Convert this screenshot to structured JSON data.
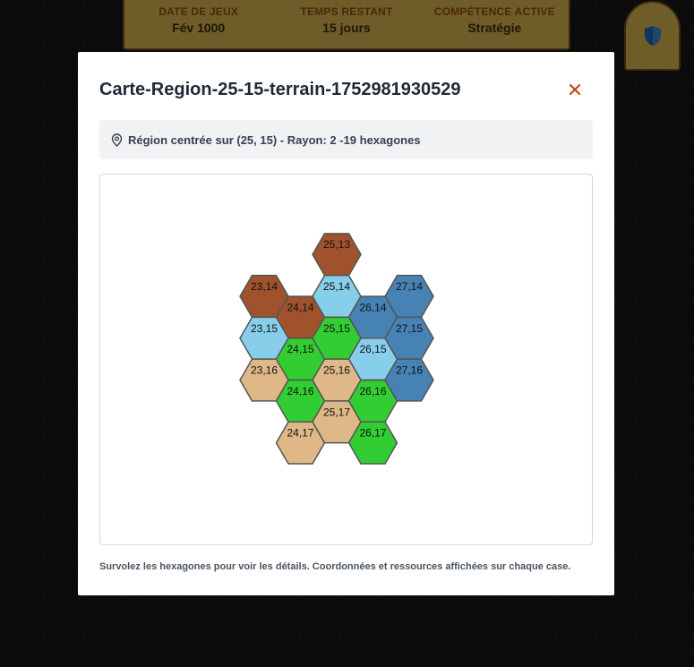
{
  "status_bar": {
    "stats": [
      {
        "label": "DATE DE JEUX",
        "value": "Fév 1000"
      },
      {
        "label": "TEMPS RESTANT",
        "value": "15 jours"
      },
      {
        "label": "COMPÉTENCE ACTIVE",
        "value": "Stratégie"
      }
    ]
  },
  "shield_button": {
    "icon": "shield-icon",
    "color": "#1e5fa8"
  },
  "modal": {
    "title": "Carte-Region-25-15-terrain-1752981930529",
    "close_icon": "close-icon",
    "info_text": "Région centrée sur (25, 15) - Rayon: 2 -19 hexagones",
    "hint": "Survolez les hexagones pour voir les détails. Coordonnées et ressources affichées sur chaque case."
  },
  "terrain_colors": {
    "brown": "#a0522d",
    "lightblue": "#87ceeb",
    "green": "#32cd32",
    "tan": "#deb887",
    "steelblue": "#4682b4"
  },
  "hexes": [
    {
      "label": "23,14",
      "q": 23,
      "r": 14,
      "terrain": "brown"
    },
    {
      "label": "25,13",
      "q": 25,
      "r": 13,
      "terrain": "brown"
    },
    {
      "label": "24,14",
      "q": 24,
      "r": 14,
      "terrain": "brown"
    },
    {
      "label": "23,15",
      "q": 23,
      "r": 15,
      "terrain": "lightblue"
    },
    {
      "label": "25,14",
      "q": 25,
      "r": 14,
      "terrain": "lightblue"
    },
    {
      "label": "26,14",
      "q": 26,
      "r": 14,
      "terrain": "steelblue"
    },
    {
      "label": "24,15",
      "q": 24,
      "r": 15,
      "terrain": "green"
    },
    {
      "label": "23,16",
      "q": 23,
      "r": 16,
      "terrain": "tan"
    },
    {
      "label": "25,15",
      "q": 25,
      "r": 15,
      "terrain": "green"
    },
    {
      "label": "27,14",
      "q": 27,
      "r": 14,
      "terrain": "steelblue"
    },
    {
      "label": "24,16",
      "q": 24,
      "r": 16,
      "terrain": "green"
    },
    {
      "label": "26,15",
      "q": 26,
      "r": 15,
      "terrain": "lightblue"
    },
    {
      "label": "25,16",
      "q": 25,
      "r": 16,
      "terrain": "tan"
    },
    {
      "label": "27,15",
      "q": 27,
      "r": 15,
      "terrain": "steelblue"
    },
    {
      "label": "24,17",
      "q": 24,
      "r": 17,
      "terrain": "tan"
    },
    {
      "label": "26,16",
      "q": 26,
      "r": 16,
      "terrain": "green"
    },
    {
      "label": "25,17",
      "q": 25,
      "r": 17,
      "terrain": "tan"
    },
    {
      "label": "27,16",
      "q": 27,
      "r": 16,
      "terrain": "steelblue"
    },
    {
      "label": "26,17",
      "q": 26,
      "r": 17,
      "terrain": "green"
    }
  ]
}
